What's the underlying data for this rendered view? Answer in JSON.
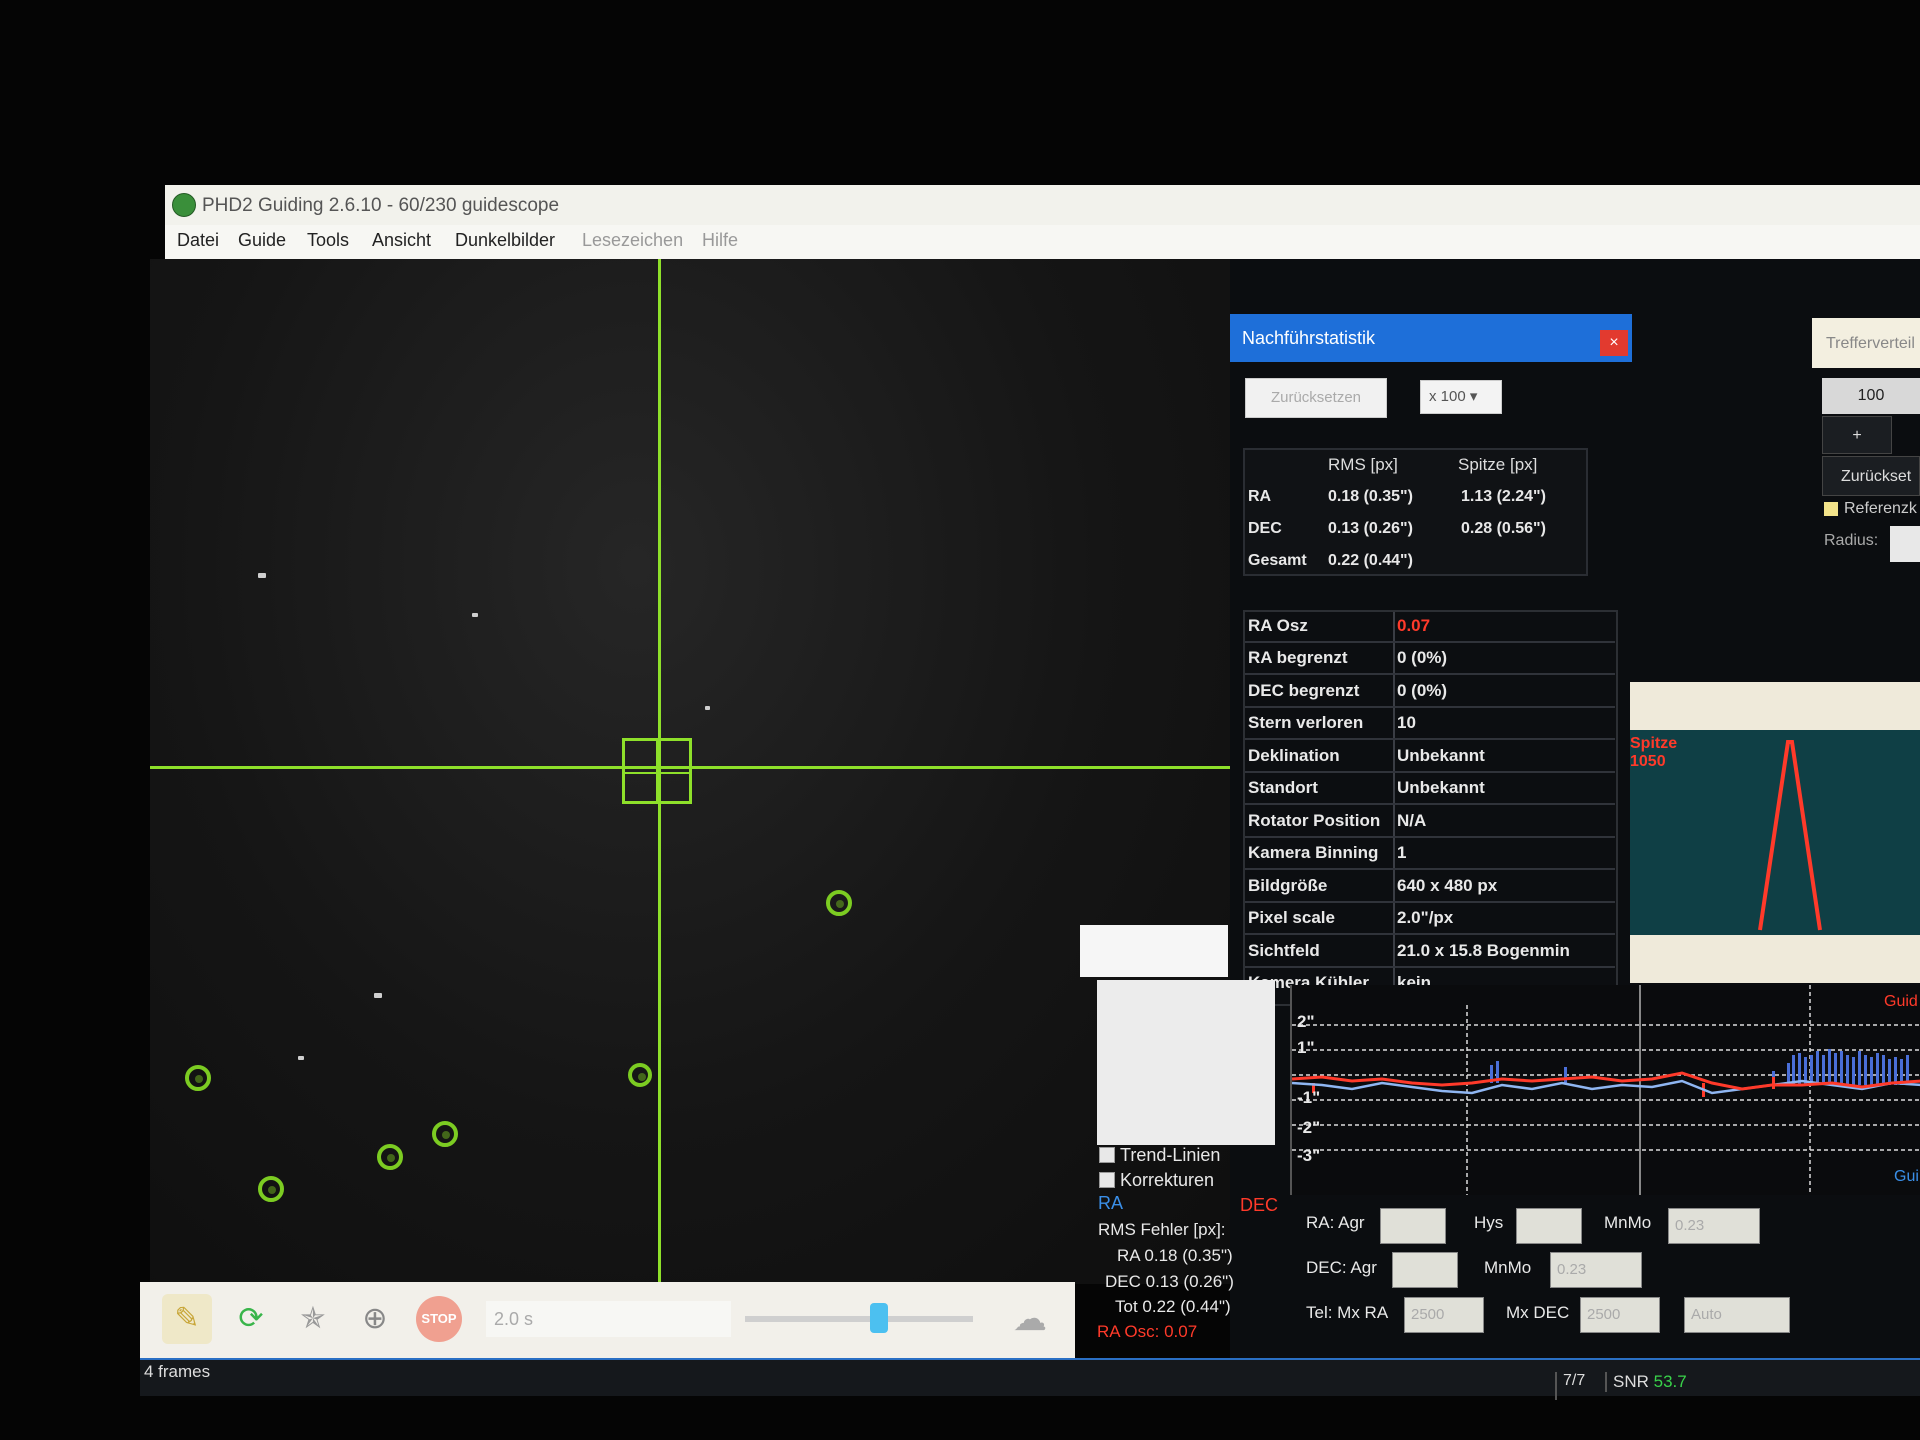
{
  "window": {
    "title": "PHD2 Guiding 2.6.10 - 60/230 guidescope"
  },
  "menu": [
    "Datei",
    "Guide",
    "Tools",
    "Ansicht",
    "Dunkelbilder",
    "Lesezeichen",
    "Hilfe"
  ],
  "stats": {
    "title": "Nachführstatistik",
    "reset_label": "Zurücksetzen",
    "range_value": "x 100",
    "col_rms": "RMS [px]",
    "col_peak": "Spitze [px]",
    "rows": [
      {
        "axis": "RA",
        "rms": "0.18 (0.35\")",
        "peak": "1.13 (2.24\")"
      },
      {
        "axis": "DEC",
        "rms": "0.13 (0.26\")",
        "peak": "0.28 (0.56\")"
      },
      {
        "axis": "Gesamt",
        "rms": "0.22 (0.44\")",
        "peak": ""
      }
    ]
  },
  "info": [
    {
      "key": "RA Osz",
      "value": "0.07",
      "color": "#ff3a2a"
    },
    {
      "key": "RA begrenzt",
      "value": "0 (0%)"
    },
    {
      "key": "DEC begrenzt",
      "value": "0 (0%)"
    },
    {
      "key": "Stern verloren",
      "value": "10"
    },
    {
      "key": "Deklination",
      "value": "Unbekannt"
    },
    {
      "key": "Standort",
      "value": "Unbekannt"
    },
    {
      "key": "Rotator Position",
      "value": "N/A"
    },
    {
      "key": "Kamera Binning",
      "value": "1"
    },
    {
      "key": "Bildgröße",
      "value": "640 x 480 px"
    },
    {
      "key": "Pixel scale",
      "value": "2.0\"/px"
    },
    {
      "key": "Sichtfeld",
      "value": "21.0 x 15.8 Bogenmin"
    },
    {
      "key": "Kamera Kühler",
      "value": "kein"
    }
  ],
  "target": {
    "panel_label": "Trefferverteil",
    "count": "100",
    "plus": "+",
    "reset_label": "Zurückset",
    "reference_label": "Referenzk",
    "radius_label": "Radius:"
  },
  "profile": {
    "label_line1": "Spitze",
    "label_line2": "1050"
  },
  "graph": {
    "y_labels": [
      "2\"",
      "1\"",
      "-1\"",
      "-2\"",
      "-3\""
    ],
    "right_label_top": "Guid",
    "right_label_bottom": "Gui"
  },
  "controls": {
    "trend_label": "Trend-Linien",
    "corrections_label": "Korrekturen",
    "ra_label": "RA",
    "dec_label": "DEC",
    "rms_title": "RMS Fehler [px]:",
    "rms_ra": "RA 0.18 (0.35\")",
    "rms_dec": "DEC 0.13 (0.26\")",
    "rms_tot": "Tot 0.22 (0.44\")",
    "ra_osc": "RA Osc: 0.07",
    "ra_agr_label": "RA: Agr",
    "hys_label": "Hys",
    "mnmo_label": "MnMo",
    "mnmo_value": "0.23",
    "dec_agr_label": "DEC: Agr",
    "dec_mnmo_label": "MnMo",
    "dec_mnmo_value": "0.23",
    "tel_label": "Tel: Mx RA",
    "mx_ra_value": "2500",
    "mx_dec_label": "Mx DEC",
    "mx_dec_value": "2500",
    "mode_value": "Auto"
  },
  "toolbar": {
    "exposure": "2.0 s",
    "stop_label": "STOP"
  },
  "status": {
    "frames": "4 frames",
    "count": "7/7",
    "snr_label": "SNR",
    "snr_value": "53.7"
  },
  "colors": {
    "crosshair": "#8ee02a",
    "ra_line": "#3a8fe8",
    "dec_line": "#ff3a2a"
  }
}
